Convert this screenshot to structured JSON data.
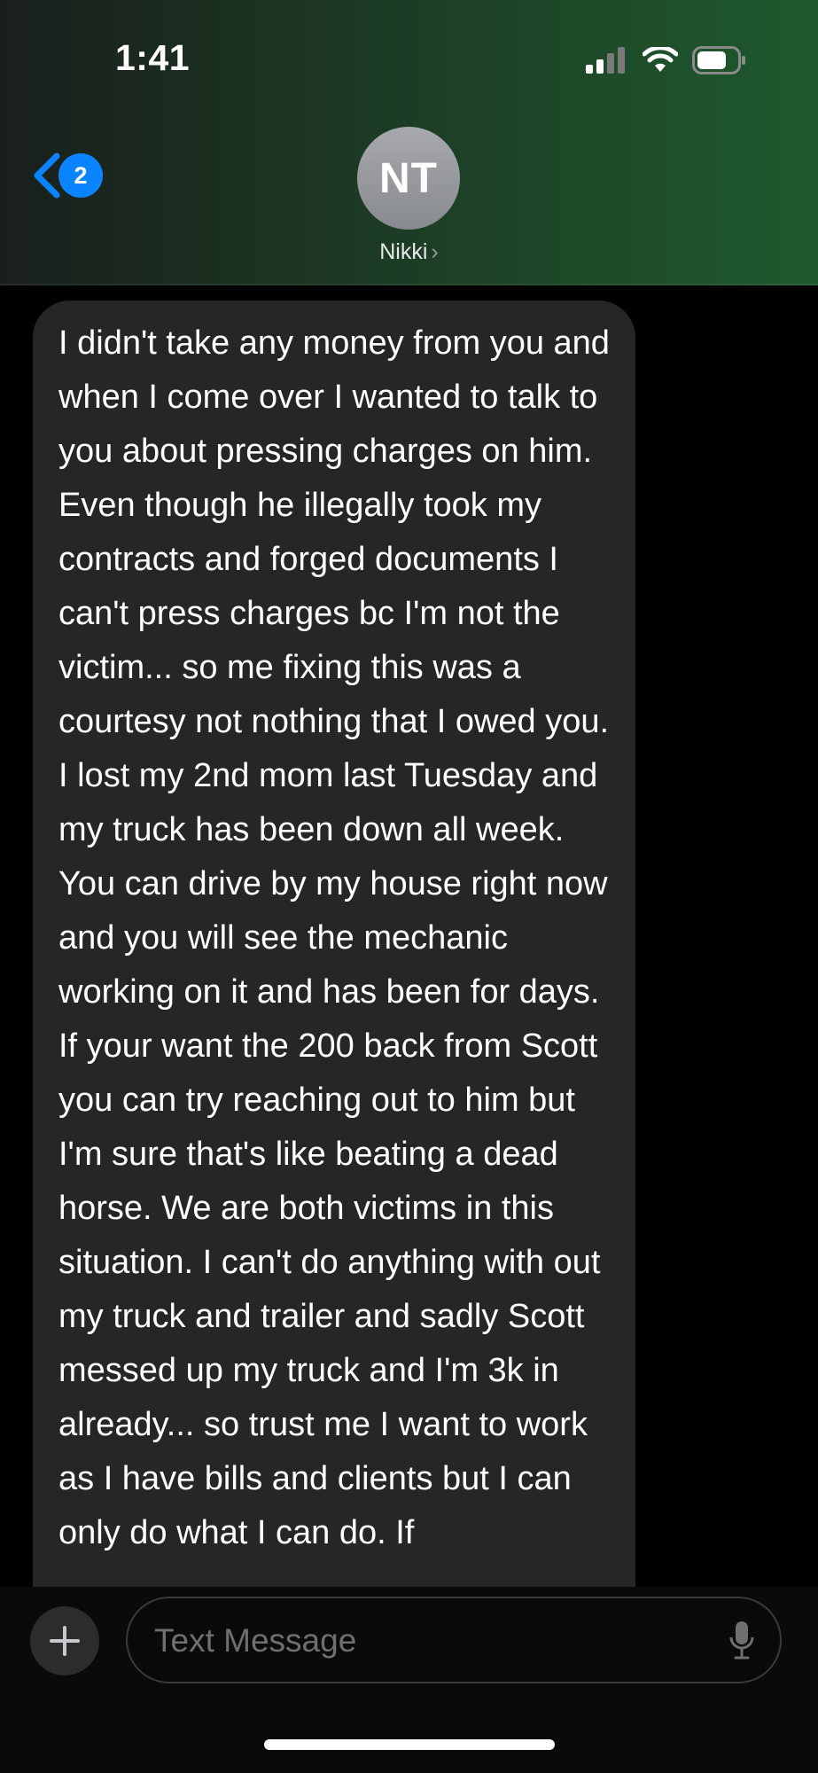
{
  "status_bar": {
    "time": "1:41",
    "icons": [
      "cellular-signal-icon",
      "wifi-icon",
      "battery-icon"
    ]
  },
  "header": {
    "back_badge_count": "2",
    "avatar_initials": "NT",
    "contact_name": "Nikki",
    "chevron": "›"
  },
  "message": {
    "direction": "incoming",
    "text": "I didn't take any money from you and when I come over I wanted to talk to you about pressing charges on him. Even though he illegally took my contracts and forged documents I can't press charges bc I'm not the victim... so me fixing this was a courtesy not nothing that I owed you. I lost my 2nd mom last Tuesday and my truck has been down all week. You can drive by my house right now and you will see the mechanic working on it and has been for days. If your want the 200 back from Scott you can try reaching out to him but I'm sure that's like beating a dead horse. We are both victims in this situation. I can't do anything with out my truck and trailer and sadly Scott messed up my truck and I'm 3k in already... so trust me I want to work as I have bills and clients but I can only do what I can do. If"
  },
  "composer": {
    "placeholder": "Text Message",
    "plus_icon": "plus-icon",
    "mic_icon": "microphone-icon"
  },
  "colors": {
    "accent": "#0a84ff",
    "bubble": "#262628",
    "header_gradient_end": "#1f5a2e"
  }
}
